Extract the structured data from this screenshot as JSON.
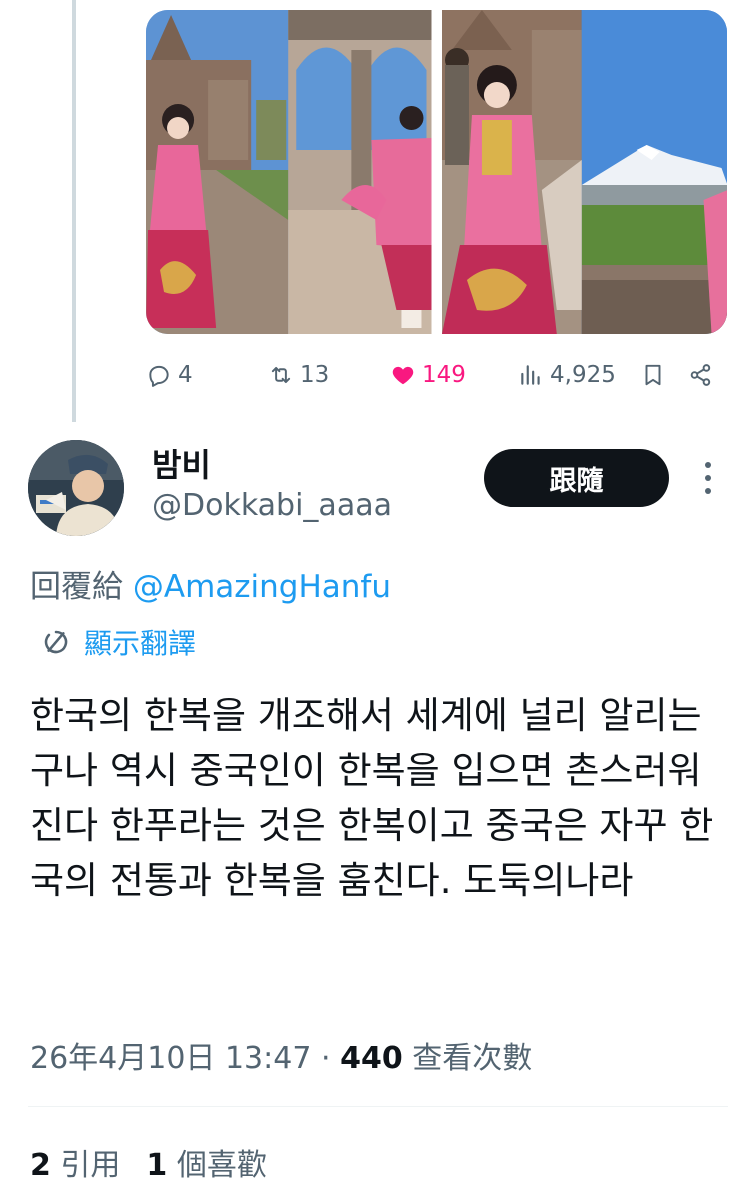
{
  "actions": {
    "replies": "4",
    "reposts": "13",
    "likes": "149",
    "views": "4,925",
    "colors": {
      "like": "#f91880",
      "muted": "#536471"
    }
  },
  "author": {
    "display_name": "밤비",
    "handle": "@Dokkabi_aaaa",
    "follow_label": "跟隨"
  },
  "reply": {
    "prefix": "回覆給",
    "mention": "@AmazingHanfu"
  },
  "translate_label": "顯示翻譯",
  "tweet": {
    "text": "한국의 한복을 개조해서 세계에 널리 알리는구나 역시 중국인이 한복을 입으면 촌스러워진다 한푸라는 것은 한복이고 중국은 자꾸 한국의 전통과 한복을 훔친다. 도둑의나라"
  },
  "meta": {
    "timestamp": "26年4月10日 13:47",
    "separator": "·",
    "view_count": "440",
    "view_label": "查看次數"
  },
  "stats": {
    "quotes_count": "2",
    "quotes_label": "引用",
    "likes_count": "1",
    "likes_label": "個喜歡"
  },
  "accent_color": "#1d9bf0"
}
